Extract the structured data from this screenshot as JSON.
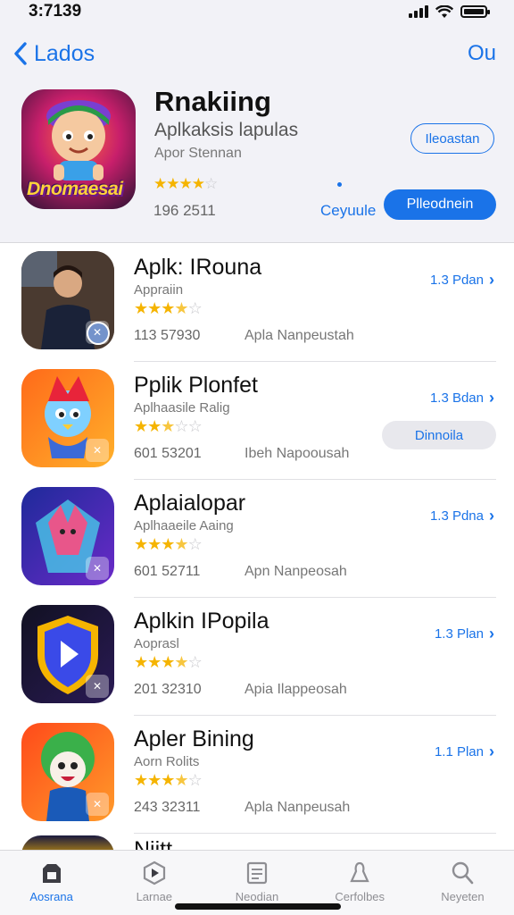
{
  "status": {
    "time": "3:7139"
  },
  "nav": {
    "back_label": "Lados",
    "right_label": "Ou"
  },
  "featured": {
    "icon_text": "Dnomaesai",
    "title": "Rnakiing",
    "subtitle": "Aplkaksis lapulas",
    "developer": "Apor Stennan",
    "rating": 4,
    "count": "196 2511",
    "outline_button": "Ileoastan",
    "link_label": "Ceyuule",
    "cta_button": "Plleodnein"
  },
  "apps": [
    {
      "name": "Aplk: IRouna",
      "category": "Appraiin",
      "rating": 3.5,
      "count": "113 57930",
      "developer": "Apla Nanpeustah",
      "price": "1.3 Pdan",
      "icon": "person",
      "colors": [
        "#3a2a22",
        "#7a5a4a"
      ]
    },
    {
      "name": "Pplik Plonfet",
      "category": "Aplhaasile Ralig",
      "rating": 2.5,
      "count": "601 53201",
      "developer": "Ibeh Napoousah",
      "price": "1.3 Bdan",
      "button": "Dinnoila",
      "icon": "bird",
      "colors": [
        "#ff6a1a",
        "#ffb02a"
      ]
    },
    {
      "name": "Aplaialopar",
      "category": "Aplhaaeile Aaing",
      "rating": 3.5,
      "count": "601 52711",
      "developer": "Apn Nanpeosah",
      "price": "1.3 Pdna",
      "icon": "fox",
      "colors": [
        "#1e2a9a",
        "#6a2ac8"
      ]
    },
    {
      "name": "Aplkin IPopila",
      "category": "Aoprasl",
      "rating": 3.5,
      "count": "201 32310",
      "developer": "Apia Ilappeosah",
      "price": "1.3 Plan",
      "icon": "play",
      "colors": [
        "#111122",
        "#2a1a55"
      ]
    },
    {
      "name": "Apler Bining",
      "category": "Aorn Rolits",
      "rating": 3.5,
      "count": "243 32311",
      "developer": "Apla Nanpeusah",
      "price": "1.1 Plan",
      "icon": "mascot",
      "colors": [
        "#ff4a1a",
        "#ff9a2a"
      ]
    }
  ],
  "partial": {
    "name": "Niitt..."
  },
  "tabs": [
    {
      "label": "Aosrana",
      "icon": "today-icon",
      "active": true
    },
    {
      "label": "Larnae",
      "icon": "games-icon",
      "active": false
    },
    {
      "label": "Neodian",
      "icon": "apps-icon",
      "active": false
    },
    {
      "label": "Cerfolbes",
      "icon": "arcade-icon",
      "active": false
    },
    {
      "label": "Neyeten",
      "icon": "search-icon",
      "active": false
    }
  ]
}
